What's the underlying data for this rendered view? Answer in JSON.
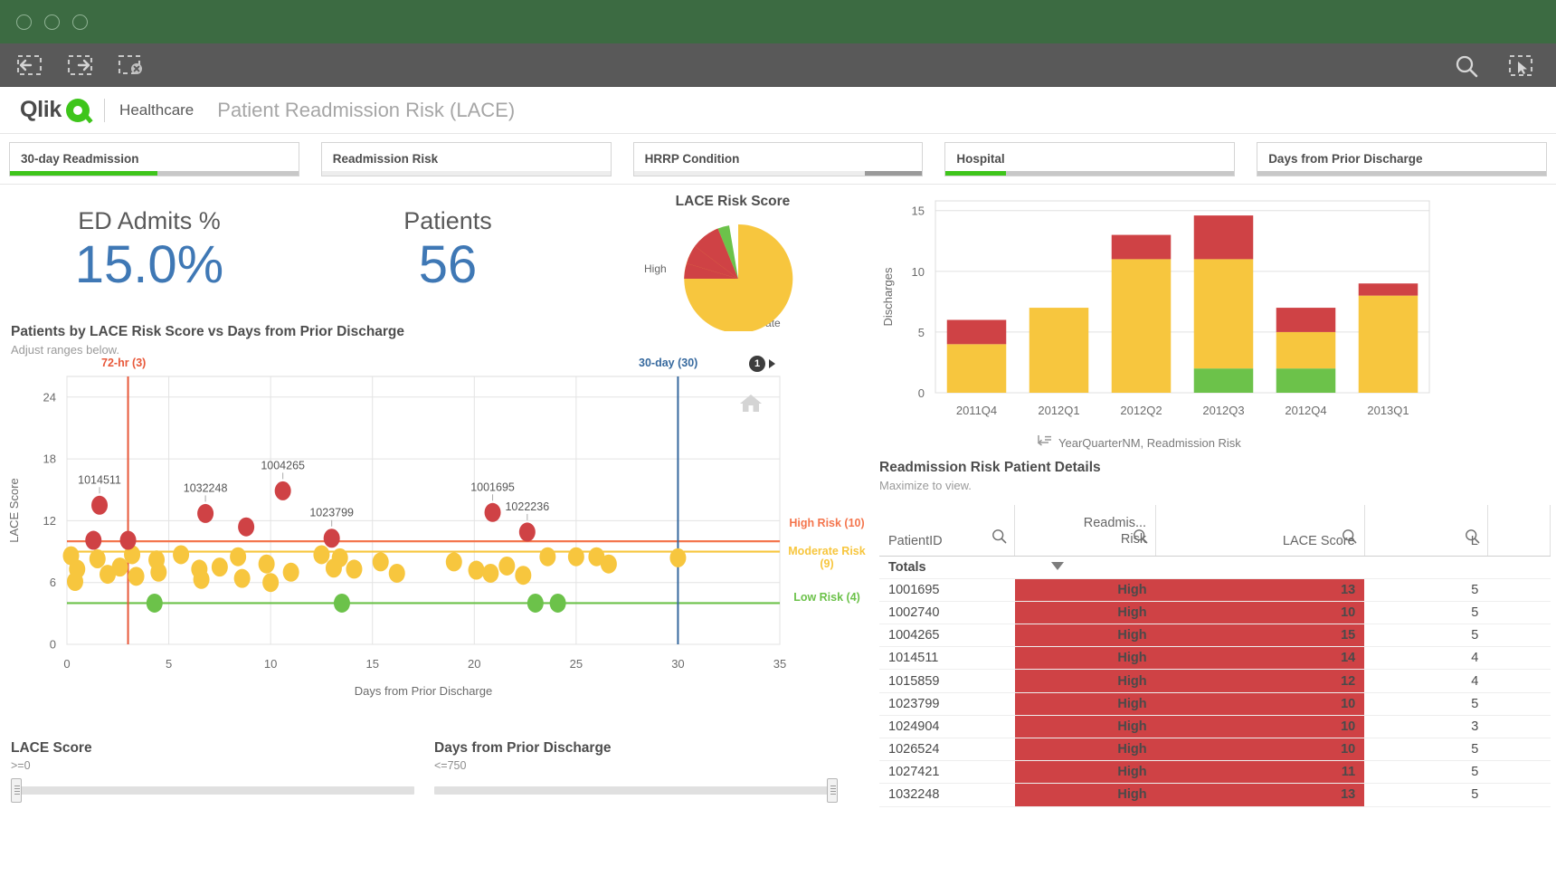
{
  "window": {
    "dots": 3
  },
  "toolbar": {
    "selection_back": "selection-back",
    "selection_forward": "selection-forward",
    "selection_clear": "clear-selections",
    "search": "smart-search",
    "selections_tool": "selections-tool"
  },
  "header": {
    "logo": "Qlik",
    "section": "Healthcare",
    "title": "Patient Readmission Risk (LACE)"
  },
  "filters": [
    {
      "label": "30-day Readmission",
      "green_pct": 51,
      "gray_pct": 49,
      "gray_dark_pct": 0
    },
    {
      "label": "Readmission Risk",
      "green_pct": 0,
      "gray_pct": 100,
      "gray_dark_pct": 0
    },
    {
      "label": "HRRP Condition",
      "green_pct": 0,
      "gray_pct": 80,
      "gray_dark_pct": 20
    },
    {
      "label": "Hospital",
      "green_pct": 21,
      "gray_pct": 79,
      "gray_dark_pct": 0
    },
    {
      "label": "Days from Prior Discharge",
      "green_pct": 0,
      "gray_pct": 100,
      "gray_dark_pct": 0
    }
  ],
  "kpis": [
    {
      "label": "ED Admits %",
      "value": "15.0%"
    },
    {
      "label": "Patients",
      "value": "56"
    }
  ],
  "pie": {
    "title": "LACE Risk Score",
    "label_high": "High",
    "label_moderate": "Moderate"
  },
  "scatter_panel": {
    "title": "Patients by LACE Risk Score vs Days from Prior Discharge",
    "subtitle": "Adjust ranges below.",
    "ref_left_label": "72-hr (3)",
    "ref_right_label": "30-day (30)",
    "info_badge": "1",
    "home_icon": "home-icon",
    "legend_high": "High Risk (10)",
    "legend_moderate": "Moderate Risk (9)",
    "legend_low": "Low Risk (4)"
  },
  "sliders": [
    {
      "title": "LACE Score",
      "value": ">=0"
    },
    {
      "title": "Days from Prior Discharge",
      "value": "<=750"
    }
  ],
  "bar_panel": {
    "axis_legend": "YearQuarterNM, Readmission Risk"
  },
  "table": {
    "title": "Readmission Risk Patient Details",
    "subtitle": "Maximize to view.",
    "columns": [
      "PatientID",
      "Readmis... Risk",
      "LACE Score",
      "L"
    ],
    "columns_line1": [
      "PatientID",
      "Readmis...",
      "LACE Score",
      "L"
    ],
    "columns_line2": [
      "",
      "Risk",
      "",
      ""
    ],
    "totals_label": "Totals",
    "rows": [
      {
        "pid": "1001695",
        "risk": "High",
        "lace": "13",
        "l": "5"
      },
      {
        "pid": "1002740",
        "risk": "High",
        "lace": "10",
        "l": "5"
      },
      {
        "pid": "1004265",
        "risk": "High",
        "lace": "15",
        "l": "5"
      },
      {
        "pid": "1014511",
        "risk": "High",
        "lace": "14",
        "l": "4"
      },
      {
        "pid": "1015859",
        "risk": "High",
        "lace": "12",
        "l": "4"
      },
      {
        "pid": "1023799",
        "risk": "High",
        "lace": "10",
        "l": "5"
      },
      {
        "pid": "1024904",
        "risk": "High",
        "lace": "10",
        "l": "3"
      },
      {
        "pid": "1026524",
        "risk": "High",
        "lace": "10",
        "l": "5"
      },
      {
        "pid": "1027421",
        "risk": "High",
        "lace": "11",
        "l": "5"
      },
      {
        "pid": "1032248",
        "risk": "High",
        "lace": "13",
        "l": "5"
      }
    ]
  },
  "colors": {
    "high": "#cf4245",
    "moderate": "#f7c63e",
    "low": "#6cc24a",
    "kpi_blue": "#3f78b5",
    "ref_red": "#e8583a",
    "ref_blue": "#36699e",
    "brand_green": "#3ec51b"
  },
  "chart_data": [
    {
      "type": "scatter",
      "title": "Patients by LACE Risk Score vs Days from Prior Discharge",
      "xlabel": "Days from Prior Discharge",
      "ylabel": "LACE Score",
      "xlim": [
        0,
        35
      ],
      "ylim": [
        0,
        26
      ],
      "xticks": [
        0,
        5,
        10,
        15,
        20,
        25,
        30,
        35
      ],
      "yticks": [
        0,
        6,
        12,
        18,
        24
      ],
      "grid": true,
      "reference_lines": [
        {
          "axis": "x",
          "value": 3,
          "label": "72-hr (3)",
          "color": "#e8583a"
        },
        {
          "axis": "x",
          "value": 30,
          "label": "30-day (30)",
          "color": "#36699e"
        },
        {
          "axis": "y",
          "value": 10,
          "label": "High Risk (10)",
          "color": "#f4764e"
        },
        {
          "axis": "y",
          "value": 9,
          "label": "Moderate Risk (9)",
          "color": "#f7c63e"
        },
        {
          "axis": "y",
          "value": 4,
          "label": "Low Risk (4)",
          "color": "#6cc24a"
        }
      ],
      "series": [
        {
          "name": "High Risk",
          "color": "#cf4245",
          "points": [
            {
              "x": 1.6,
              "y": 13.5,
              "label": "1014511"
            },
            {
              "x": 6.8,
              "y": 12.7,
              "label": "1032248"
            },
            {
              "x": 10.6,
              "y": 14.9,
              "label": "1004265"
            },
            {
              "x": 20.9,
              "y": 12.8,
              "label": "1001695"
            },
            {
              "x": 8.8,
              "y": 11.4,
              "label": ""
            },
            {
              "x": 13.0,
              "y": 10.3,
              "label": "1023799"
            },
            {
              "x": 22.6,
              "y": 10.9,
              "label": "1022236"
            },
            {
              "x": 1.3,
              "y": 10.1,
              "label": ""
            },
            {
              "x": 3.0,
              "y": 10.1,
              "label": ""
            }
          ]
        },
        {
          "name": "Moderate Risk",
          "color": "#f7c63e",
          "points": [
            {
              "x": 0.2,
              "y": 8.6
            },
            {
              "x": 0.5,
              "y": 7.3
            },
            {
              "x": 0.4,
              "y": 6.1
            },
            {
              "x": 1.5,
              "y": 8.3
            },
            {
              "x": 2.0,
              "y": 6.8
            },
            {
              "x": 2.6,
              "y": 7.5
            },
            {
              "x": 3.2,
              "y": 8.7
            },
            {
              "x": 3.4,
              "y": 6.6
            },
            {
              "x": 4.4,
              "y": 8.2
            },
            {
              "x": 4.5,
              "y": 7.0
            },
            {
              "x": 5.6,
              "y": 8.7
            },
            {
              "x": 6.5,
              "y": 7.3
            },
            {
              "x": 6.6,
              "y": 6.3
            },
            {
              "x": 7.5,
              "y": 7.5
            },
            {
              "x": 8.4,
              "y": 8.5
            },
            {
              "x": 8.6,
              "y": 6.4
            },
            {
              "x": 10.0,
              "y": 6.0
            },
            {
              "x": 11.0,
              "y": 7.0
            },
            {
              "x": 12.5,
              "y": 8.7
            },
            {
              "x": 13.1,
              "y": 7.4
            },
            {
              "x": 14.1,
              "y": 7.3
            },
            {
              "x": 15.4,
              "y": 8.0
            },
            {
              "x": 16.2,
              "y": 6.9
            },
            {
              "x": 19.0,
              "y": 8.0
            },
            {
              "x": 20.1,
              "y": 7.2
            },
            {
              "x": 20.8,
              "y": 6.9
            },
            {
              "x": 21.6,
              "y": 7.6
            },
            {
              "x": 22.4,
              "y": 6.7
            },
            {
              "x": 25.0,
              "y": 8.5
            },
            {
              "x": 26.0,
              "y": 8.5
            },
            {
              "x": 26.6,
              "y": 7.8
            },
            {
              "x": 30.0,
              "y": 8.4
            },
            {
              "x": 23.6,
              "y": 8.5
            },
            {
              "x": 13.4,
              "y": 8.4
            },
            {
              "x": 9.8,
              "y": 7.8
            }
          ]
        },
        {
          "name": "Low Risk",
          "color": "#6cc24a",
          "points": [
            {
              "x": 4.3,
              "y": 4.0
            },
            {
              "x": 13.5,
              "y": 4.0
            },
            {
              "x": 23.0,
              "y": 4.0
            },
            {
              "x": 24.1,
              "y": 4.0
            }
          ]
        }
      ]
    },
    {
      "type": "pie",
      "title": "LACE Risk Score",
      "labels": [
        "Moderate",
        "High",
        "Low"
      ],
      "values": [
        35,
        10,
        4
      ],
      "colors": [
        "#f7c63e",
        "#cf4245",
        "#6cc24a"
      ]
    },
    {
      "type": "bar",
      "stacked": true,
      "xlabel": "YearQuarterNM, Readmission Risk",
      "ylabel": "Discharges",
      "categories": [
        "2011Q4",
        "2012Q1",
        "2012Q2",
        "2012Q3",
        "2012Q4",
        "2013Q1"
      ],
      "yticks": [
        0,
        5,
        10,
        15
      ],
      "ylim": [
        0,
        15.8
      ],
      "series": [
        {
          "name": "Low",
          "color": "#6cc24a",
          "values": [
            0,
            0,
            0,
            2,
            2,
            0
          ]
        },
        {
          "name": "Moderate",
          "color": "#f7c63e",
          "values": [
            4,
            7,
            11,
            9,
            3,
            8
          ]
        },
        {
          "name": "High",
          "color": "#cf4245",
          "values": [
            2,
            0,
            2,
            3.6,
            2,
            1
          ]
        }
      ]
    }
  ]
}
